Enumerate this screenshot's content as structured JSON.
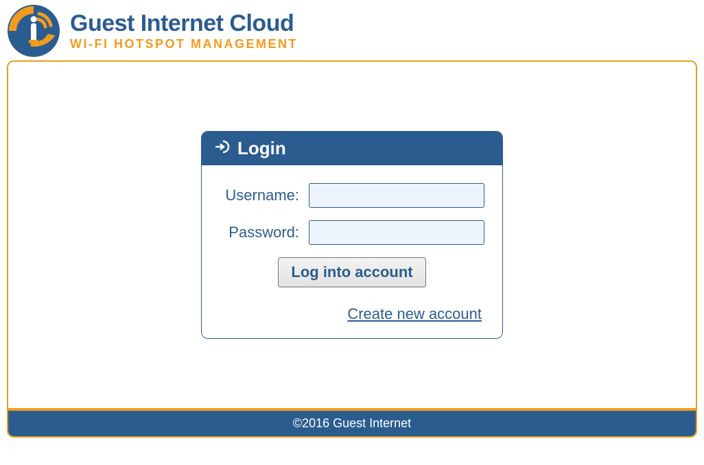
{
  "brand": {
    "title": "Guest Internet Cloud",
    "subtitle": "WI-FI HOTSPOT MANAGEMENT"
  },
  "colors": {
    "primary": "#2b5c8f",
    "accent": "#f29b1e",
    "input_bg": "#ecf3fb"
  },
  "login": {
    "title": "Login",
    "username_label": "Username:",
    "username_value": "",
    "password_label": "Password:",
    "password_value": "",
    "button_label": "Log into account",
    "create_link": "Create new account"
  },
  "footer": {
    "text": "©2016 Guest Internet"
  },
  "icons": {
    "login_icon": "login-arrow-icon"
  }
}
